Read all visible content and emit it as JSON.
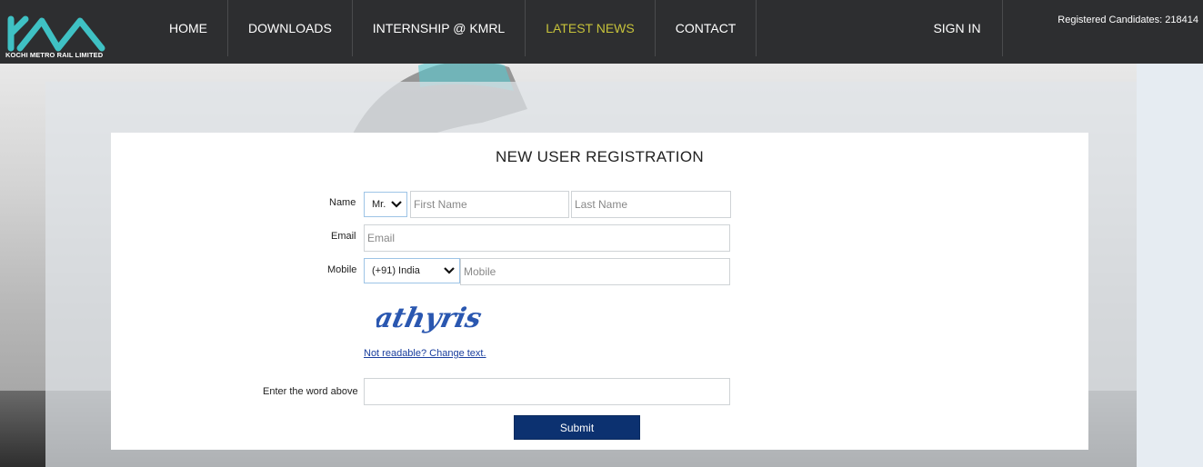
{
  "header": {
    "logo_text": "KOCHI METRO RAIL LIMITED",
    "nav": [
      {
        "label": "HOME",
        "active": false
      },
      {
        "label": "DOWNLOADS",
        "active": false
      },
      {
        "label": "INTERNSHIP @ KMRL",
        "active": false
      },
      {
        "label": "LATEST NEWS",
        "active": true
      },
      {
        "label": "CONTACT",
        "active": false
      }
    ],
    "sign_in": "SIGN IN",
    "registered_candidates": "Registered Candidates: 218414"
  },
  "form": {
    "title": "NEW USER REGISTRATION",
    "name_label": "Name",
    "salutation": "Mr.",
    "first_name_placeholder": "First Name",
    "last_name_placeholder": "Last Name",
    "email_label": "Email",
    "email_placeholder": "Email",
    "mobile_label": "Mobile",
    "country_code": "(+91) India",
    "mobile_placeholder": "Mobile",
    "captcha_text": "athyris",
    "change_captcha_link": "Not readable? Change text.",
    "captcha_label": "Enter the word above",
    "submit_label": "Submit"
  },
  "colors": {
    "header_bg": "#2d2e30",
    "active_nav": "#c6c23a",
    "submit_bg": "#0c3170",
    "logo_teal": "#3fc1c4"
  }
}
